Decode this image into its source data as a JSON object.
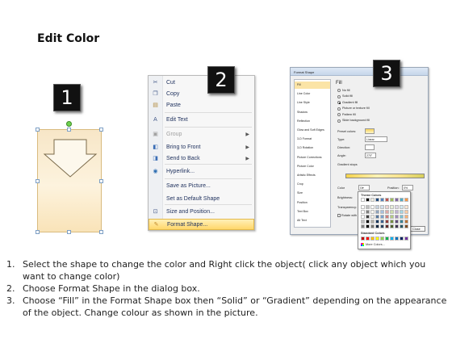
{
  "title": "Edit Color",
  "steps": [
    "1",
    "2",
    "3"
  ],
  "context_menu": {
    "items": [
      {
        "label": "Cut",
        "icon": "scissors-icon",
        "glyph": "✂",
        "color": "#445a8a",
        "disabled": false,
        "submenu": false
      },
      {
        "label": "Copy",
        "icon": "copy-icon",
        "glyph": "❐",
        "color": "#445a8a",
        "disabled": false,
        "submenu": false
      },
      {
        "label": "Paste",
        "icon": "paste-icon",
        "glyph": "▤",
        "color": "#b08a3c",
        "disabled": false,
        "submenu": false
      },
      {
        "label": "Edit Text",
        "icon": "edit-text-icon",
        "glyph": "A",
        "color": "#445a8a",
        "disabled": false,
        "submenu": false
      },
      {
        "label": "Group",
        "icon": "group-icon",
        "glyph": "▣",
        "color": "#a0a0a0",
        "disabled": true,
        "submenu": true
      },
      {
        "label": "Bring to Front",
        "icon": "bring-to-front-icon",
        "glyph": "◧",
        "color": "#3a6db5",
        "disabled": false,
        "submenu": true
      },
      {
        "label": "Send to Back",
        "icon": "send-to-back-icon",
        "glyph": "◨",
        "color": "#3a6db5",
        "disabled": false,
        "submenu": true
      },
      {
        "label": "Hyperlink...",
        "icon": "hyperlink-icon",
        "glyph": "◉",
        "color": "#2f6fb3",
        "disabled": false,
        "submenu": false
      },
      {
        "label": "Save as Picture...",
        "icon": "",
        "glyph": "",
        "color": "#445a8a",
        "disabled": false,
        "submenu": false
      },
      {
        "label": "Set as Default Shape",
        "icon": "",
        "glyph": "",
        "color": "#445a8a",
        "disabled": false,
        "submenu": false
      },
      {
        "label": "Size and Position...",
        "icon": "size-position-icon",
        "glyph": "⊡",
        "color": "#445a8a",
        "disabled": false,
        "submenu": false
      },
      {
        "label": "Format Shape...",
        "icon": "format-shape-icon",
        "glyph": "✎",
        "color": "#c0892b",
        "disabled": false,
        "submenu": false,
        "highlighted": true
      }
    ]
  },
  "dialog": {
    "title": "Format Shape",
    "sidebar": [
      "Fill",
      "Line Color",
      "Line Style",
      "Shadow",
      "Reflection",
      "Glow and Soft Edges",
      "3-D Format",
      "3-D Rotation",
      "Picture Corrections",
      "Picture Color",
      "Artistic Effects",
      "Crop",
      "Size",
      "Position",
      "Text Box",
      "Alt Text"
    ],
    "section_title": "Fill",
    "fill_options": [
      "No fill",
      "Solid fill",
      "Gradient fill",
      "Picture or texture fill",
      "Pattern fill",
      "Slide background fill"
    ],
    "selected_fill": 2,
    "preset_colors_label": "Preset colors:",
    "type_label": "Type:",
    "type_value": "Linear",
    "direction_label": "Direction:",
    "angle_label": "Angle:",
    "angle_value": "270°",
    "gradient_stops_label": "Gradient stops",
    "color_label": "Color",
    "position_label": "Position:",
    "position_value": "0%",
    "brightness_label": "Brightness:",
    "transparency_label": "Transparency:",
    "rotate_label": "Rotate with shape",
    "close_button": "Close"
  },
  "palette": {
    "theme_label": "Theme Colors",
    "standard_label": "Standard Colors",
    "more_label": "More Colors...",
    "theme_top": [
      "#ffffff",
      "#000000",
      "#eeece1",
      "#1f497d",
      "#4f81bd",
      "#c0504d",
      "#9bbb59",
      "#8064a2",
      "#4bacc6",
      "#f79646"
    ],
    "standard": [
      "#c00000",
      "#ff0000",
      "#ffc000",
      "#ffff00",
      "#92d050",
      "#00b050",
      "#00b0f0",
      "#0070c0",
      "#002060",
      "#7030a0"
    ]
  },
  "instructions": [
    {
      "num": "1.",
      "text": "Select the shape to change the color and Right click the object( click any object which you want to change color)"
    },
    {
      "num": "2.",
      "text": "Choose Format Shape in the dialog box."
    },
    {
      "num": "3.",
      "text": "Choose “Fill” in the Format Shape box then “Solid” or “Gradient” depending on the appearance of the object. Change colour as shown in the picture."
    }
  ]
}
